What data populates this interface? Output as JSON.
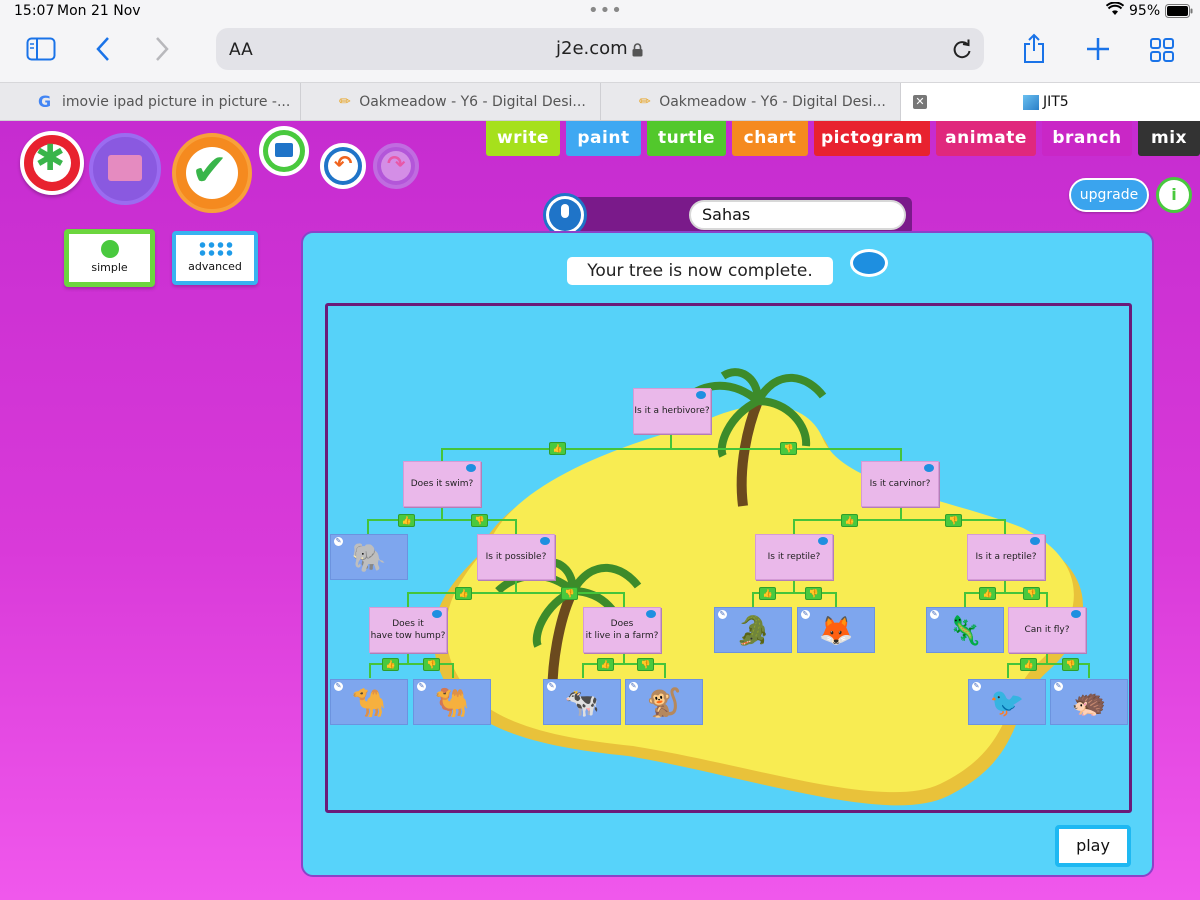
{
  "status": {
    "time": "15:07",
    "date": "Mon 21 Nov",
    "battery": "95%"
  },
  "browser": {
    "aa_label": "AA",
    "url": "j2e.com",
    "tabs": [
      {
        "label": "imovie ipad picture in picture -..."
      },
      {
        "label": "Oakmeadow - Y6 - Digital Desi..."
      },
      {
        "label": "Oakmeadow - Y6 - Digital Desi..."
      },
      {
        "label": "JIT5"
      }
    ]
  },
  "app": {
    "modes": [
      "write",
      "paint",
      "turtle",
      "chart",
      "pictogram",
      "animate",
      "branch",
      "mix"
    ],
    "mode_colors": [
      "#a6e01c",
      "#3ea8f2",
      "#52c82c",
      "#f58a1f",
      "#e8222f",
      "#e0287d",
      "#c927c6",
      "#333333"
    ],
    "upgrade_label": "upgrade",
    "info_label": "i",
    "name_value": "Sahas",
    "simple_label": "simple",
    "advanced_label": "advanced",
    "message": "Your tree is now complete.",
    "play_label": "play",
    "questions": {
      "q1": "Is it a herbivore?",
      "q2": "Does it swim?",
      "q3": "Is it carvinor?",
      "q4": "Is it possible?",
      "q5": "Is it reptile?",
      "q6": "Is it a reptile?",
      "q7": "Does it\nhave tow hump?",
      "q8": "Does\nit live in a farm?",
      "q9": "Can it fly?"
    },
    "answers": [
      "elephant",
      "camel-1",
      "camel-2",
      "cow",
      "monkey",
      "crocodile",
      "fox",
      "chameleon",
      "bird",
      "anteater"
    ]
  }
}
